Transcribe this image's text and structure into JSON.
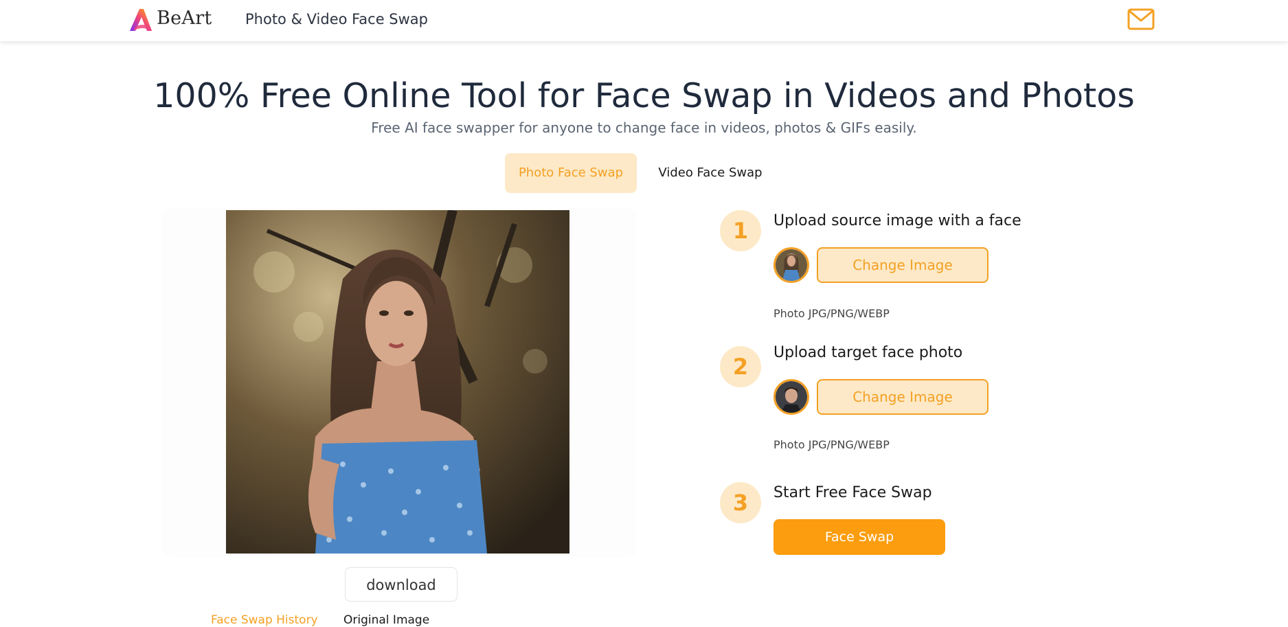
{
  "header": {
    "brand": "BeArt",
    "nav_link": "Photo & Video Face Swap",
    "icons": {
      "logo": "beart-logo-icon",
      "mail": "mail-icon"
    }
  },
  "hero": {
    "title": "100% Free Online Tool for Face Swap in Videos and Photos",
    "subtitle": "Free AI face swapper for anyone to change face in videos, photos & GIFs easily."
  },
  "tabs": [
    {
      "label": "Photo Face Swap",
      "active": true
    },
    {
      "label": "Video Face Swap",
      "active": false
    }
  ],
  "preview": {
    "download_label": "download",
    "history_label": "Face Swap History",
    "original_label": "Original Image"
  },
  "steps": [
    {
      "number": "1",
      "title": "Upload source image with a face",
      "button": "Change Image",
      "hint": "Photo JPG/PNG/WEBP"
    },
    {
      "number": "2",
      "title": "Upload target face photo",
      "button": "Change Image",
      "hint": "Photo JPG/PNG/WEBP"
    },
    {
      "number": "3",
      "title": "Start Free Face Swap",
      "button": "Face Swap"
    }
  ],
  "colors": {
    "accent": "#f4a024",
    "accent_light": "#fde9c7",
    "button": "#fb9d0e",
    "title": "#1f2a3c"
  }
}
